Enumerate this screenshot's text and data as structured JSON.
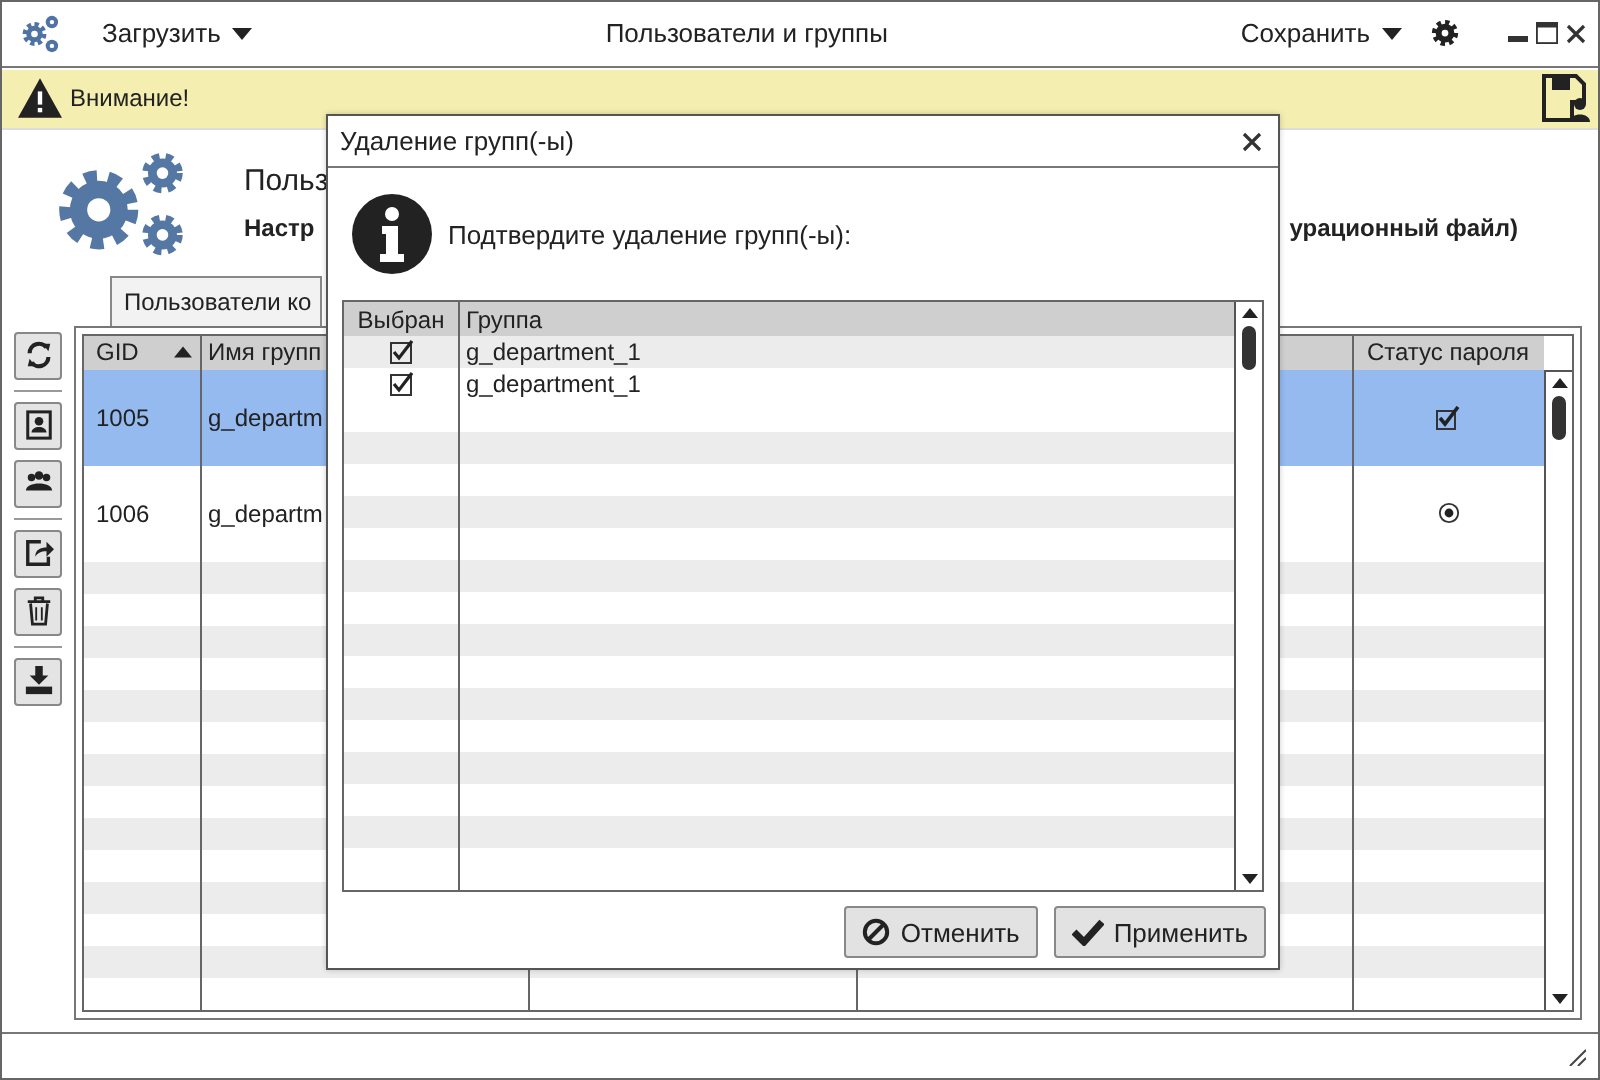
{
  "app": {
    "load_menu": "Загрузить",
    "title": "Пользователи и группы",
    "save_menu": "Сохранить"
  },
  "warning": {
    "text": "Внимание!"
  },
  "header": {
    "title": "Польз",
    "subtitle_left": "Настр",
    "subtitle_right": "урационный файл)"
  },
  "tabs": [
    {
      "label": "Пользователи ко",
      "selected": true
    }
  ],
  "table": {
    "columns": [
      "GID",
      "Имя групп",
      "Статус пароля"
    ],
    "rows": [
      {
        "gid": "1005",
        "name": "g_departm",
        "kind": "checkbox",
        "selected": true
      },
      {
        "gid": "1006",
        "name": "g_departm",
        "kind": "radio",
        "selected": false
      }
    ]
  },
  "dialog": {
    "title": "Удаление групп(-ы)",
    "message": "Подтвердите удаление групп(-ы):",
    "columns": [
      "Выбран",
      "Группа"
    ],
    "rows": [
      {
        "checked": true,
        "group": "g_department_1"
      },
      {
        "checked": true,
        "group": "g_department_1"
      }
    ],
    "buttons": [
      {
        "label": "Отменить",
        "kind": "cancel"
      },
      {
        "label": "Применить",
        "kind": "apply"
      }
    ]
  }
}
